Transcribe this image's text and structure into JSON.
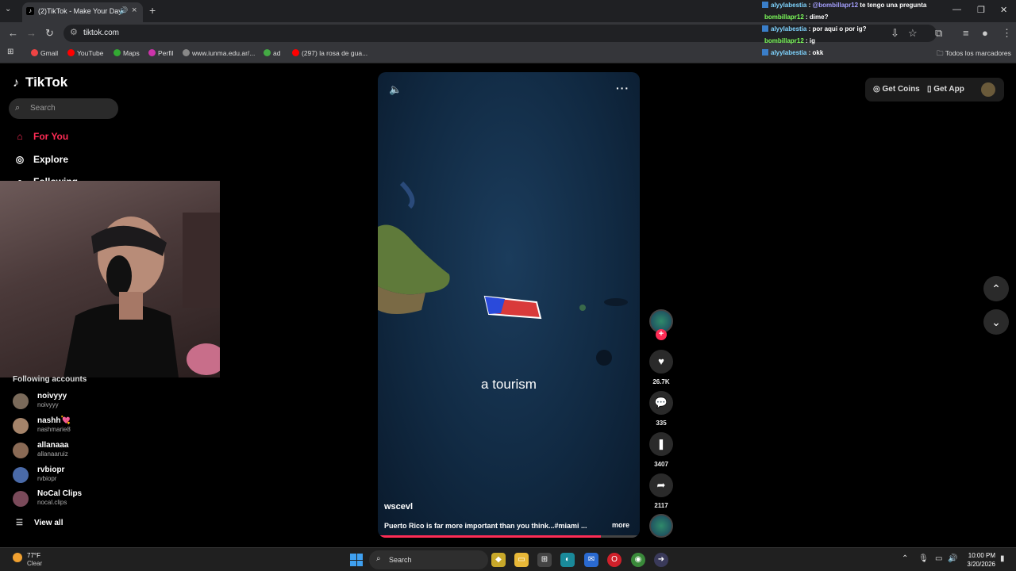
{
  "browser": {
    "tab_title": "(2)TikTok - Make Your Day",
    "url": "tiktok.com",
    "bookmarks": [
      "Gmail",
      "YouTube",
      "Maps",
      "Perfil",
      "www.iunma.edu.ar/...",
      "ad",
      "(297) la rosa de gua..."
    ],
    "all_bookmarks": "Todos los marcadores"
  },
  "chat": [
    {
      "user": "alyylabestia",
      "mention": "@bombillapr12",
      "text": " te tengo una pregunta"
    },
    {
      "user": "bombillapr12",
      "mention": "",
      "text": " dime?"
    },
    {
      "user": "alyylabestia",
      "mention": "",
      "text": " por aqui o por ig?"
    },
    {
      "user": "bombillapr12",
      "mention": "",
      "text": " ig"
    },
    {
      "user": "alyylabestia",
      "mention": "",
      "text": " okk"
    }
  ],
  "tiktok": {
    "logo": "TikTok",
    "search_placeholder": "Search",
    "nav": [
      "For You",
      "Explore",
      "Following"
    ],
    "following_title": "Following accounts",
    "accounts": [
      {
        "name": "noivyyy",
        "handle": "noivyyy"
      },
      {
        "name": "nashh💘",
        "handle": "nashmarie8"
      },
      {
        "name": "allanaaa",
        "handle": "allanaaruiz"
      },
      {
        "name": "rvbiopr",
        "handle": "rvbiopr"
      },
      {
        "name": "NoCal Clips",
        "handle": "nocal.clips"
      }
    ],
    "view_all": "View all",
    "get_coins": "Get Coins",
    "get_app": "Get App"
  },
  "video": {
    "caption": "a tourism",
    "username": "wscevl",
    "description": "Puerto Rico is far more important than you think...#miami ...",
    "more": "more",
    "progress": 0.85,
    "likes": "26.7K",
    "comments": "335",
    "saves": "3407",
    "shares": "2117"
  },
  "taskbar": {
    "temp": "77°F",
    "weather": "Clear",
    "search": "Search",
    "time": "10:00 PM",
    "date": "3/20/2026"
  },
  "colors": {
    "brand": "#fe2c55",
    "chat_user_blue": "#7fd4ff",
    "chat_user_green": "#7cfc5a"
  }
}
